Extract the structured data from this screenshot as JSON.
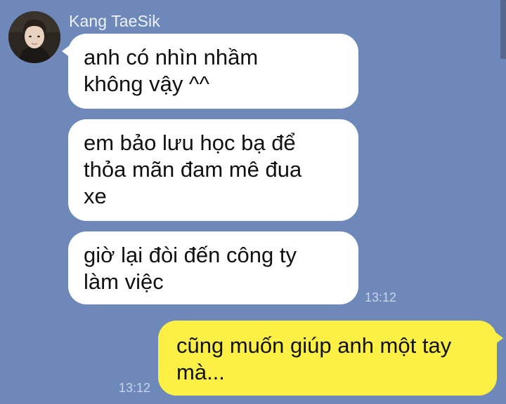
{
  "chat": {
    "sender": {
      "name": "Kang TaeSik",
      "avatar_icon": "profile-photo"
    },
    "messages": [
      {
        "direction": "incoming",
        "text": "anh có nhìn nhầm\nkhông vậy ^^"
      },
      {
        "direction": "incoming",
        "text": "em bảo lưu học bạ để\nthỏa mãn đam mê đua\nxe"
      },
      {
        "direction": "incoming",
        "text": "giờ lại đòi đến công ty\nlàm việc",
        "time": "13:12"
      },
      {
        "direction": "outgoing",
        "text": "cũng muốn giúp anh một tay\nmà...",
        "time": "13:12"
      }
    ]
  },
  "colors": {
    "background": "#6e88b9",
    "incoming_bubble": "#ffffff",
    "outgoing_bubble": "#fcf046",
    "text": "#111111",
    "meta_text": "#c9d4e9"
  }
}
